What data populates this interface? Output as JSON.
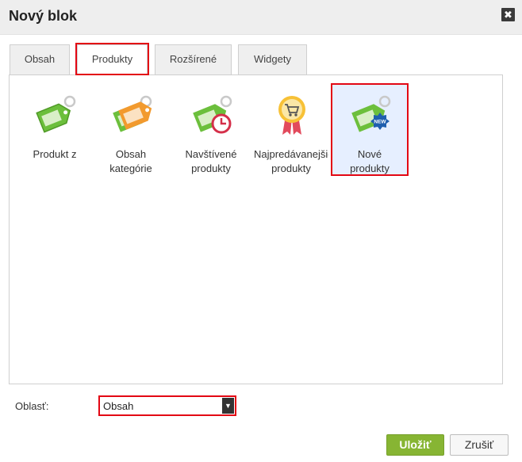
{
  "dialog": {
    "title": "Nový blok",
    "close_glyph": "✖"
  },
  "tabs": [
    {
      "label": "Obsah",
      "active": false
    },
    {
      "label": "Produkty",
      "active": true
    },
    {
      "label": "Rozšírené",
      "active": false
    },
    {
      "label": "Widgety",
      "active": false
    }
  ],
  "blocks": [
    {
      "line1": "Produkt z",
      "line2": "",
      "icon": "green-tag-icon"
    },
    {
      "line1": "Obsah",
      "line2": "kategórie",
      "icon": "green-orange-tags-icon"
    },
    {
      "line1": "Navštívené",
      "line2": "produkty",
      "icon": "tag-clock-icon"
    },
    {
      "line1": "Najpredávanejšie",
      "line2": "produkty",
      "icon": "award-cart-icon"
    },
    {
      "line1": "Nové",
      "line2": "produkty",
      "icon": "tag-new-badge-icon",
      "selected": true
    }
  ],
  "area": {
    "label": "Oblasť:",
    "selected": "Obsah"
  },
  "buttons": {
    "save": "Uložiť",
    "cancel": "Zrušiť"
  },
  "colors": {
    "save_button": "#87b533",
    "highlight": "#e30613",
    "selected_bg": "#e6efff"
  }
}
